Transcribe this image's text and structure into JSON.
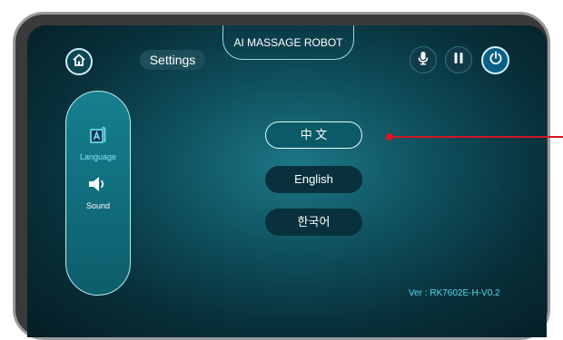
{
  "header": {
    "title": "AI MASSAGE ROBOT",
    "settings_label": "Settings"
  },
  "sidebar": {
    "items": [
      {
        "label": "Language",
        "icon": "language-icon",
        "active": true
      },
      {
        "label": "Sound",
        "icon": "speaker-icon",
        "active": false
      }
    ]
  },
  "languages": {
    "options": [
      "中 文",
      "English",
      "한국어"
    ],
    "selected": "中 文"
  },
  "footer": {
    "version": "Ver : RK7602E-H-V0.2"
  },
  "icons": {
    "home": "home-icon",
    "mic": "microphone-icon",
    "pause": "pause-icon",
    "power": "power-icon"
  },
  "colors": {
    "accent": "#8fdbe3",
    "active_label": "#7fe6ff",
    "annotation": "#e01425",
    "power_button": "#0a5f86"
  }
}
